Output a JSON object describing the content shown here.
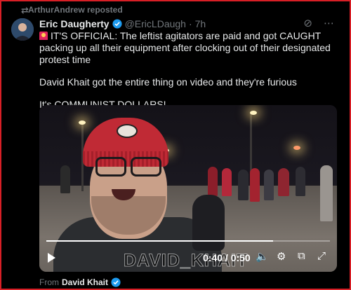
{
  "repost": {
    "label": "ArthurAndrew reposted",
    "icon": "repost-icon"
  },
  "author": {
    "name": "Eric Daugherty",
    "handle": "@EricLDaugh",
    "time": "7h"
  },
  "tweet": {
    "line1": "IT'S OFFICIAL: The leftist agitators are paid and got CAUGHT packing up all their equipment after clocking out of their designated protest time",
    "line2": "David Khait got the entire thing on video and they're furious",
    "line3": "It's COMMUNIST DOLLARS!"
  },
  "video": {
    "watermark": "DAVID_KHAIT",
    "time_label": "0:40 / 0:50",
    "progress": 0.8
  },
  "source": {
    "prefix": "From",
    "name": "David Khait"
  },
  "colors": {
    "verified": "#1d9bf0",
    "frame": "#d81f26",
    "muted": "#71767b"
  }
}
